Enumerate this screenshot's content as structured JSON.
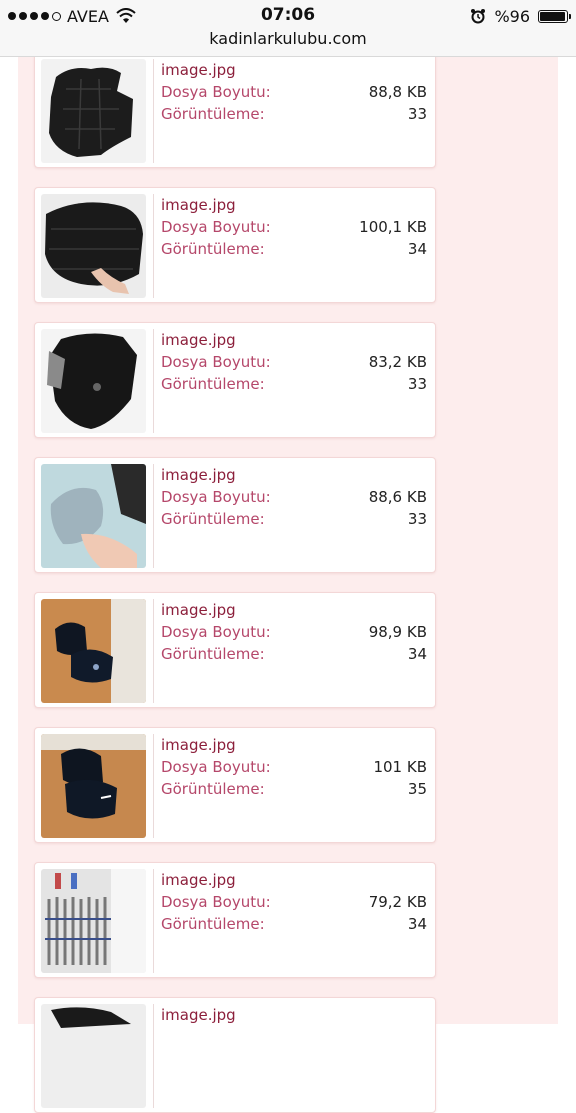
{
  "status_bar": {
    "carrier": "AVEA",
    "time": "07:06",
    "url": "kadinlarkulubu.com",
    "battery_text": "%96",
    "battery_level": 0.96
  },
  "labels": {
    "size": "Dosya Boyutu:",
    "views": "Görüntüleme:"
  },
  "files": [
    {
      "name": "image.jpg",
      "size": "88,8 KB",
      "views": "33"
    },
    {
      "name": "image.jpg",
      "size": "100,1 KB",
      "views": "34"
    },
    {
      "name": "image.jpg",
      "size": "83,2 KB",
      "views": "33"
    },
    {
      "name": "image.jpg",
      "size": "88,6 KB",
      "views": "33"
    },
    {
      "name": "image.jpg",
      "size": "98,9 KB",
      "views": "34"
    },
    {
      "name": "image.jpg",
      "size": "101 KB",
      "views": "35"
    },
    {
      "name": "image.jpg",
      "size": "79,2 KB",
      "views": "34"
    },
    {
      "name": "image.jpg"
    }
  ]
}
